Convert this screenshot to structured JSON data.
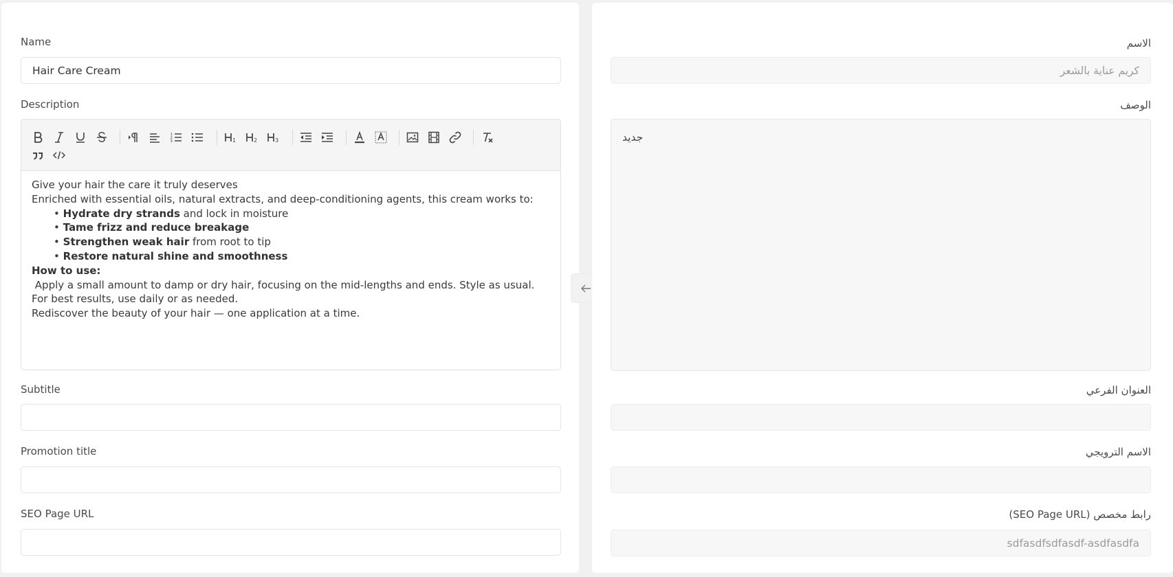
{
  "left": {
    "name_label": "Name",
    "name_value": "Hair Care Cream",
    "description_label": "Description",
    "description": {
      "line1": "Give your hair the care it truly deserves",
      "line2": "Enriched with essential oils, natural extracts, and deep-conditioning agents, this cream works to:",
      "bullets": [
        {
          "marker": "•",
          "bold": "Hydrate dry strands",
          "rest": " and lock in moisture"
        },
        {
          "marker": "•",
          "bold": "Tame frizz and reduce breakage",
          "rest": ""
        },
        {
          "marker": "•",
          "bold": "Strengthen weak hair",
          "rest": " from root to tip"
        },
        {
          "marker": "•",
          "bold": "Restore natural shine and smoothness",
          "rest": ""
        }
      ],
      "howto_heading": "How to use:",
      "howto_text": " Apply a small amount to damp or dry hair, focusing on the mid-lengths and ends. Style as usual. For best results, use daily or as needed.",
      "closing": "Rediscover the beauty of your hair — one application at a time."
    },
    "subtitle_label": "Subtitle",
    "subtitle_value": "",
    "promotion_label": "Promotion title",
    "promotion_value": "",
    "seo_label": "SEO Page URL",
    "seo_value": ""
  },
  "right": {
    "name_label": "الاسم",
    "name_value": "كريم عناية بالشعر",
    "description_label": "الوصف",
    "description_value": "جديد",
    "subtitle_label": "العنوان الفرعي",
    "subtitle_value": "",
    "promotion_label": "الاسم الترويجي",
    "promotion_value": "",
    "seo_label": "رابط مخصص (SEO Page URL)",
    "seo_value": "sdfasdfsdfasdf-asdfasdfa"
  },
  "toolbar": {
    "row1": [
      "bold-icon",
      "italic-icon",
      "underline-icon",
      "strikethrough-icon",
      "text-direction-icon",
      "align-left-icon",
      "ordered-list-icon",
      "unordered-list-icon",
      "heading1-icon",
      "heading2-icon",
      "heading3-icon",
      "outdent-icon",
      "indent-icon",
      "text-color-icon",
      "background-color-icon",
      "image-icon",
      "video-icon",
      "link-icon",
      "clear-format-icon"
    ],
    "row2": [
      "blockquote-icon",
      "code-block-icon"
    ]
  },
  "swap_icon": "arrow-left-icon"
}
